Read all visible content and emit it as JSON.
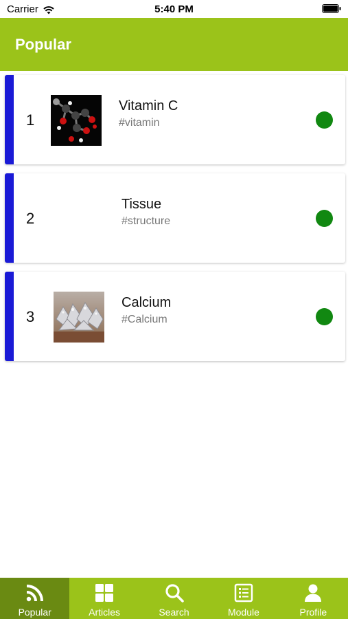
{
  "status_bar": {
    "carrier": "Carrier",
    "time": "5:40 PM"
  },
  "header": {
    "title": "Popular"
  },
  "items": [
    {
      "rank": "1",
      "title": "Vitamin C",
      "tag": "#vitamin",
      "image": "molecule-image",
      "accent_color": "#1a1ad6",
      "status_color": "#118811"
    },
    {
      "rank": "2",
      "title": "Tissue",
      "tag": "#structure",
      "image": null,
      "accent_color": "#1a1ad6",
      "status_color": "#118811"
    },
    {
      "rank": "3",
      "title": "Calcium",
      "tag": "#Calcium",
      "image": "calcium-crystals-image",
      "accent_color": "#1a1ad6",
      "status_color": "#118811"
    }
  ],
  "tabs": [
    {
      "label": "Popular",
      "icon": "rss-icon",
      "active": true
    },
    {
      "label": "Articles",
      "icon": "grid-icon",
      "active": false
    },
    {
      "label": "Search",
      "icon": "search-icon",
      "active": false
    },
    {
      "label": "Module",
      "icon": "module-list-icon",
      "active": false
    },
    {
      "label": "Profile",
      "icon": "person-icon",
      "active": false
    }
  ],
  "colors": {
    "brand": "#9bc31a",
    "brand_active": "#6a8a12",
    "accent": "#1a1ad6",
    "status_ok": "#118811"
  }
}
